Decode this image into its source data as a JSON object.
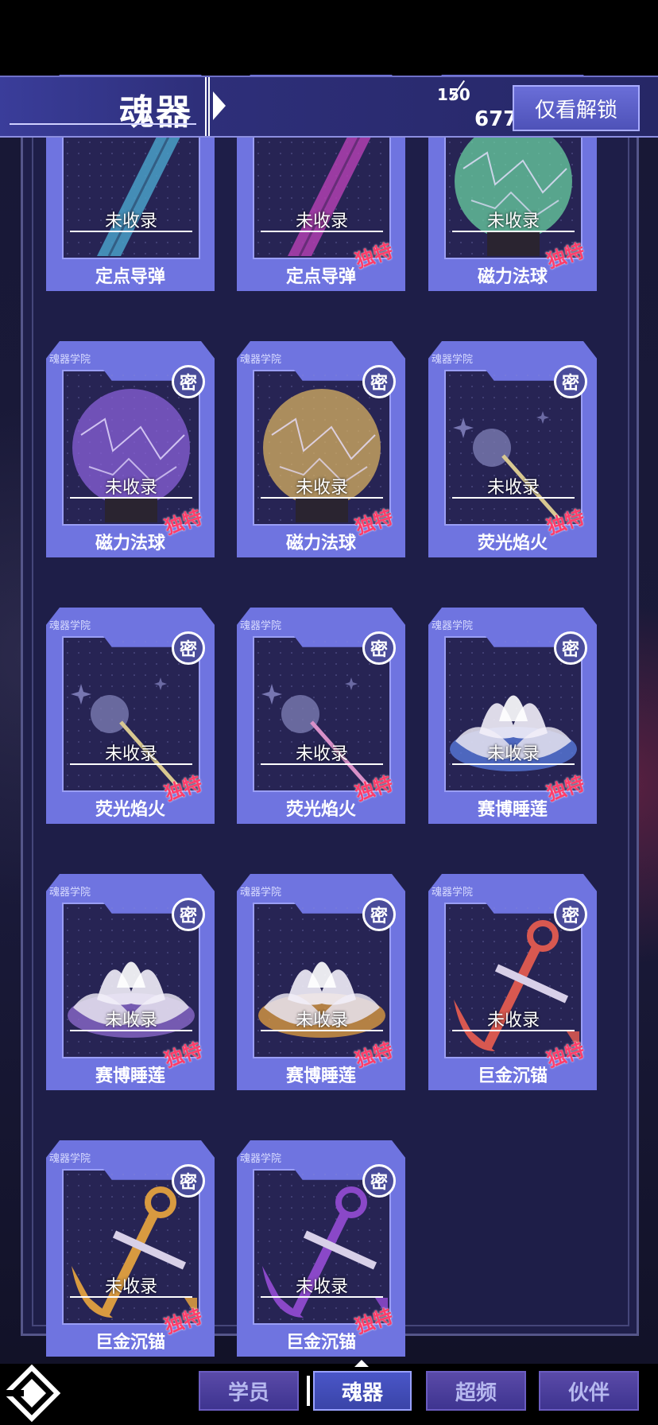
{
  "header": {
    "title": "魂器",
    "collected_count": "150",
    "total_count": "677",
    "filter_button_label": "仅看解锁"
  },
  "card_common": {
    "tab_label": "魂器学院",
    "lock_label": "密",
    "status_label": "未收录",
    "unique_label": "独特"
  },
  "cards": [
    {
      "name": "定点导弹",
      "art": "missile",
      "color": "#4aa0c8",
      "unique": false,
      "locked_badge": false
    },
    {
      "name": "定点导弹",
      "art": "missile",
      "color": "#b040b0",
      "unique": true,
      "locked_badge": false
    },
    {
      "name": "磁力法球",
      "art": "orb",
      "color": "#6ad0a0",
      "unique": true,
      "locked_badge": false
    },
    {
      "name": "磁力法球",
      "art": "orb",
      "color": "#8a60d8",
      "unique": true,
      "locked_badge": true
    },
    {
      "name": "磁力法球",
      "art": "orb",
      "color": "#d8b060",
      "unique": true,
      "locked_badge": true
    },
    {
      "name": "荧光焰火",
      "art": "wand",
      "color": "#d8c890",
      "unique": true,
      "locked_badge": true
    },
    {
      "name": "荧光焰火",
      "art": "wand",
      "color": "#d8c890",
      "unique": true,
      "locked_badge": true
    },
    {
      "name": "荧光焰火",
      "art": "wand",
      "color": "#d890c8",
      "unique": true,
      "locked_badge": true
    },
    {
      "name": "赛博睡莲",
      "art": "lotus",
      "color": "#5878d8",
      "unique": true,
      "locked_badge": true
    },
    {
      "name": "赛博睡莲",
      "art": "lotus",
      "color": "#8a68c8",
      "unique": true,
      "locked_badge": true
    },
    {
      "name": "赛博睡莲",
      "art": "lotus",
      "color": "#d89840",
      "unique": true,
      "locked_badge": true
    },
    {
      "name": "巨金沉锚",
      "art": "anchor",
      "color": "#d85850",
      "unique": true,
      "locked_badge": true
    },
    {
      "name": "巨金沉锚",
      "art": "anchor",
      "color": "#d89a40",
      "unique": true,
      "locked_badge": true
    },
    {
      "name": "巨金沉锚",
      "art": "anchor",
      "color": "#8a48c8",
      "unique": true,
      "locked_badge": true
    }
  ],
  "nav": {
    "tabs": [
      "学员",
      "魂器",
      "超频",
      "伙伴"
    ],
    "active_index": 1
  }
}
